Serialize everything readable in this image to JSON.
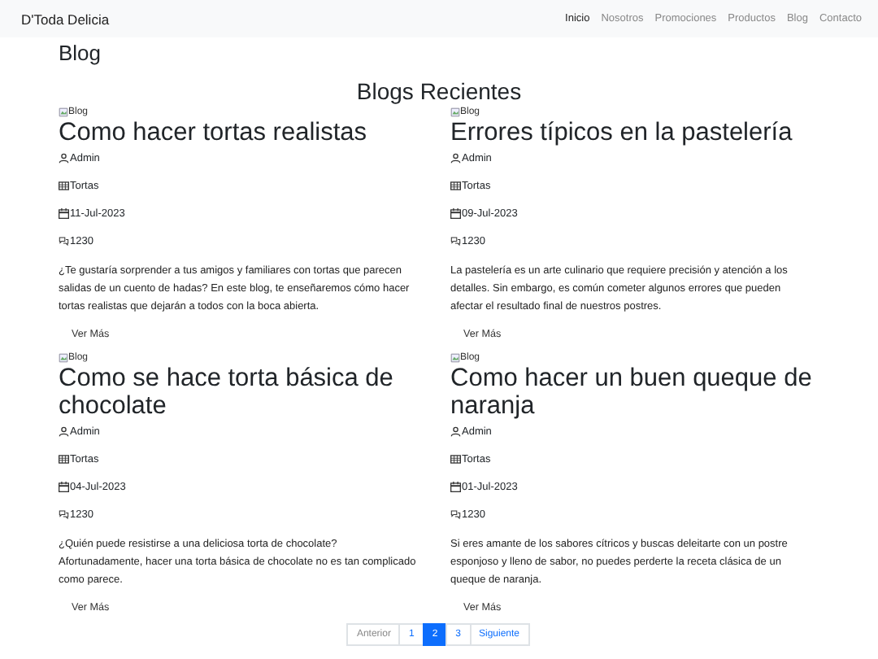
{
  "navbar": {
    "brand": "D'Toda Delicia",
    "items": [
      {
        "label": "Inicio",
        "selected": true
      },
      {
        "label": "Nosotros",
        "selected": false
      },
      {
        "label": "Promociones",
        "selected": false
      },
      {
        "label": "Productos",
        "selected": false
      },
      {
        "label": "Blog",
        "selected": false
      },
      {
        "label": "Contacto",
        "selected": false
      }
    ]
  },
  "page_title": "Blog",
  "section_title": "Blogs Recientes",
  "posts": [
    {
      "image_alt": "Blog",
      "title": "Como hacer tortas realistas",
      "author": "Admin",
      "category": "Tortas",
      "date": "11-Jul-2023",
      "comments": "1230",
      "excerpt": "¿Te gustaría sorprender a tus amigos y familiares con tortas que parecen salidas de un cuento de hadas? En este blog, te enseñaremos cómo hacer tortas realistas que dejarán a todos con la boca abierta.",
      "link": "Ver Más"
    },
    {
      "image_alt": "Blog",
      "title": "Errores típicos en la pastelería",
      "author": "Admin",
      "category": "Tortas",
      "date": "09-Jul-2023",
      "comments": "1230",
      "excerpt": "La pastelería es un arte culinario que requiere precisión y atención a los detalles. Sin embargo, es común cometer algunos errores que pueden afectar el resultado final de nuestros postres.",
      "link": "Ver Más"
    },
    {
      "image_alt": "Blog",
      "title": "Como se hace torta básica de chocolate",
      "author": "Admin",
      "category": "Tortas",
      "date": "04-Jul-2023",
      "comments": "1230",
      "excerpt": "¿Quién puede resistirse a una deliciosa torta de chocolate? Afortunadamente, hacer una torta básica de chocolate no es tan complicado como parece.",
      "link": "Ver Más"
    },
    {
      "image_alt": "Blog",
      "title": "Como hacer un buen queque de naranja",
      "author": "Admin",
      "category": "Tortas",
      "date": "01-Jul-2023",
      "comments": "1230",
      "excerpt": "Si eres amante de los sabores cítricos y buscas deleitarte con un postre esponjoso y lleno de sabor, no puedes perderte la receta clásica de un queque de naranja.",
      "link": "Ver Más"
    }
  ],
  "pagination": [
    {
      "label": "Anterior",
      "selected": false,
      "disabled": true
    },
    {
      "label": "1",
      "selected": false,
      "disabled": false
    },
    {
      "label": "2",
      "selected": true,
      "disabled": false
    },
    {
      "label": "3",
      "selected": false,
      "disabled": false
    },
    {
      "label": "Siguiente",
      "selected": false,
      "disabled": false
    }
  ]
}
